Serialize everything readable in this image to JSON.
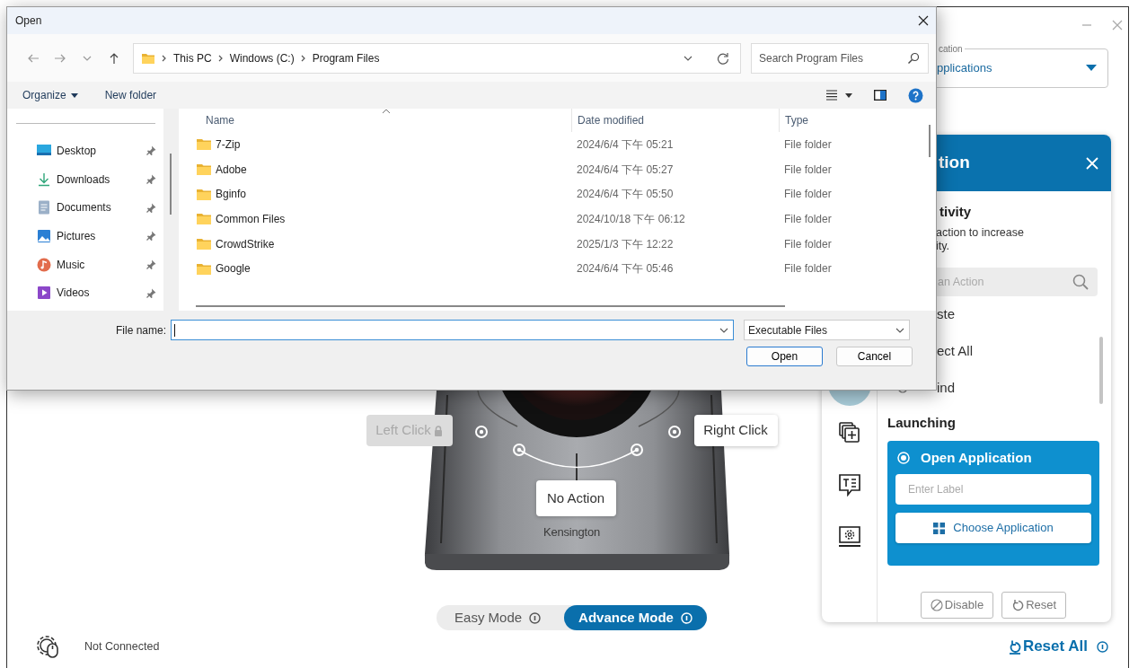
{
  "dialog": {
    "title": "Open",
    "path": [
      "This PC",
      "Windows (C:)",
      "Program Files"
    ],
    "search": {
      "placeholder": "Search Program Files"
    },
    "toolbar": [
      {
        "label": "Organize",
        "menu": true
      },
      {
        "label": "New folder",
        "menu": false
      }
    ],
    "sidebar": {
      "items": [
        {
          "label": "Desktop",
          "kind": "desktop",
          "pinned": true
        },
        {
          "label": "Downloads",
          "kind": "downloads",
          "pinned": true
        },
        {
          "label": "Documents",
          "kind": "documents",
          "pinned": true
        },
        {
          "label": "Pictures",
          "kind": "pictures",
          "pinned": true
        },
        {
          "label": "Music",
          "kind": "music",
          "pinned": true
        },
        {
          "label": "Videos",
          "kind": "videos",
          "pinned": true
        }
      ]
    },
    "files": {
      "columns": [
        "Name",
        "Date modified",
        "Type"
      ],
      "rows": [
        {
          "name": "7-Zip",
          "date": "2024/6/4 下午 05:21",
          "type": "File folder"
        },
        {
          "name": "Adobe",
          "date": "2024/6/4 下午 05:27",
          "type": "File folder"
        },
        {
          "name": "Bginfo",
          "date": "2024/6/4 下午 05:50",
          "type": "File folder"
        },
        {
          "name": "Common Files",
          "date": "2024/10/18 下午 06:12",
          "type": "File folder"
        },
        {
          "name": "CrowdStrike",
          "date": "2025/1/3 下午 12:22",
          "type": "File folder"
        },
        {
          "name": "Google",
          "date": "2024/6/4 下午 05:46",
          "type": "File folder"
        }
      ]
    },
    "file_name": {
      "label": "File name:"
    },
    "file_type": "Executable Files",
    "buttons": [
      {
        "label": "Open",
        "default": true
      },
      {
        "label": "Cancel",
        "default": false
      }
    ]
  },
  "app": {
    "application_select": {
      "label": "cation",
      "value": "pplications"
    },
    "panel": {
      "title": "tion",
      "section_title": "tivity",
      "description": [
        "action to increase",
        "ity."
      ],
      "search": {
        "placeholder": "an Action"
      },
      "actions": [
        {
          "label": "ste",
          "selected": false
        },
        {
          "label": "ect All",
          "selected": false
        },
        {
          "label": "ind",
          "selected": false
        }
      ],
      "nav_icons": [
        {
          "kind": "keyboard",
          "selected": true
        },
        {
          "kind": "windows-plus",
          "selected": false
        },
        {
          "kind": "text-bubble",
          "selected": false
        },
        {
          "kind": "gear-screen",
          "selected": false
        }
      ],
      "group_title": "Launching",
      "option": {
        "label": "Open Application",
        "selected": true,
        "label_field": {
          "placeholder": "Enter Label"
        },
        "button": "Choose Application"
      },
      "buttons": [
        {
          "label": "Disable",
          "kind": "disable"
        },
        {
          "label": "Reset",
          "kind": "reset"
        }
      ]
    },
    "device": {
      "brand": "Kensington",
      "labels": [
        {
          "label": "Left Click",
          "locked": true
        },
        {
          "label": "Right Click",
          "locked": false
        },
        {
          "label": "No Action",
          "locked": false
        }
      ]
    },
    "modes": [
      {
        "label": "Easy Mode",
        "selected": false
      },
      {
        "label": "Advance Mode",
        "selected": true
      }
    ],
    "status": "Not Connected",
    "reset_all": "Reset All"
  }
}
